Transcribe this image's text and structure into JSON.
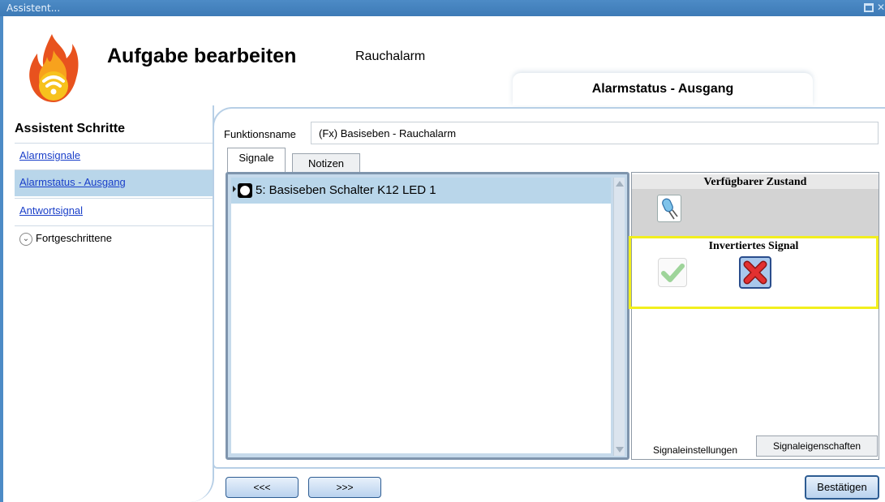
{
  "window": {
    "title": "Assistent..."
  },
  "header": {
    "title": "Aufgabe bearbeiten",
    "subtitle": "Rauchalarm",
    "step_title": "Alarmstatus - Ausgang"
  },
  "sidebar": {
    "title": "Assistent Schritte",
    "items": [
      {
        "label": "Alarmsignale"
      },
      {
        "label": "Alarmstatus - Ausgang"
      },
      {
        "label": "Antwortsignal"
      }
    ],
    "advanced_label": "Fortgeschrittene"
  },
  "form": {
    "function_name_label": "Funktionsname",
    "function_name_value": "(Fx) Basiseben - Rauchalarm"
  },
  "tabs": [
    {
      "label": "Signale"
    },
    {
      "label": "Notizen"
    }
  ],
  "signals": [
    {
      "label": "5: Basiseben Schalter K12 LED 1"
    }
  ],
  "settings": {
    "available_state_title": "Verfügbarer Zustand",
    "inverted_signal_title": "Invertiertes Signal",
    "bottom_tabs": [
      {
        "label": "Signaleinstellungen"
      },
      {
        "label": "Signaleigenschaften"
      }
    ]
  },
  "nav": {
    "back_label": "<<<",
    "next_label": ">>>",
    "confirm_label": "Bestätigen"
  },
  "colors": {
    "titlebar": "#4d8bc6",
    "selection": "#b9d6ea",
    "highlight_border": "#f2ef1d",
    "link": "#1a3fc9"
  }
}
